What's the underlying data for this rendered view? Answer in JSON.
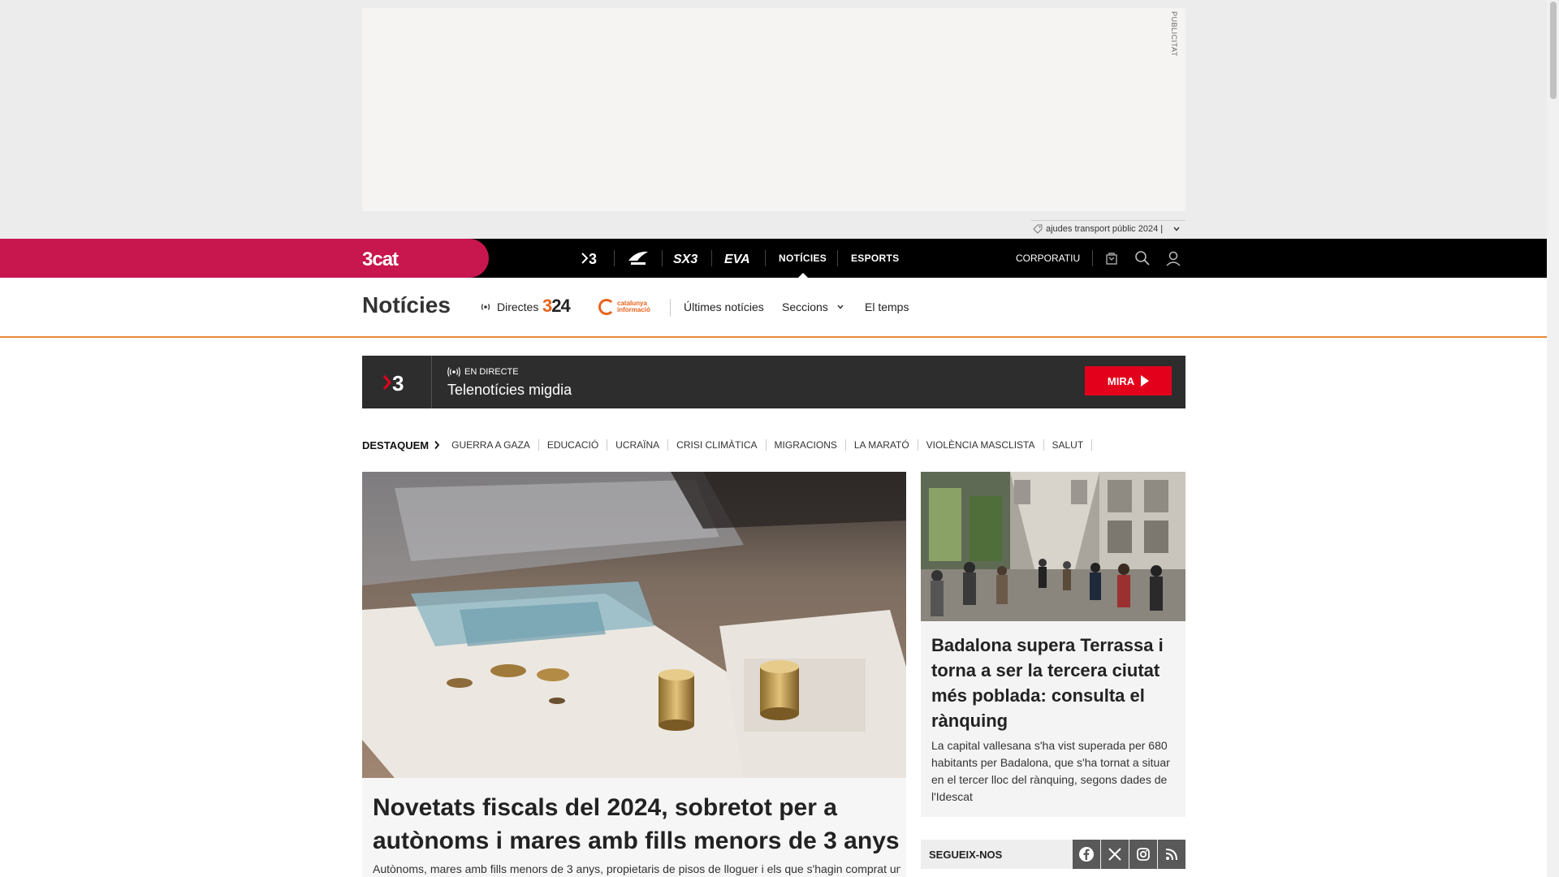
{
  "ad": {
    "label": "PUBLICITAT",
    "footer_text": "ajudes transport públic 2024 |"
  },
  "topnav": {
    "brand": "3cat",
    "channels": [
      {
        "name": "3-icon"
      },
      {
        "name": "catradio-icon",
        "label": "Cat ràdio"
      },
      {
        "name": "sx3-icon",
        "label": "SX3"
      },
      {
        "name": "eva-icon",
        "label": "EVA"
      }
    ],
    "noticies": "NOTÍCIES",
    "esports": "ESPORTS",
    "corporatiu": "CORPORATIU"
  },
  "section": {
    "title": "Notícies",
    "directes": "Directes",
    "logo_324_a": "3",
    "logo_324_b": "24",
    "logo_ci": "catalunya informació",
    "links": [
      "Últimes notícies",
      "Seccions",
      "El temps"
    ]
  },
  "live": {
    "channel": "3",
    "tag": "EN DIRECTE",
    "title": "Telenotícies migdia",
    "button": "MIRA"
  },
  "highlights": {
    "title": "DESTAQUEM",
    "items": [
      "GUERRA A GAZA",
      "EDUCACIÓ",
      "UCRAÏNA",
      "CRISI CLIMÀTICA",
      "MIGRACIONS",
      "LA MARATÓ",
      "VIOLÈNCIA MASCLISTA",
      "SALUT"
    ]
  },
  "main_story": {
    "headline": "Novetats fiscals del 2024, sobretot per a autònoms i mares amb fills menors de 3 anys",
    "summary": "Autònoms, mares amb fills menors de 3 anys, propietaris de pisos de lloguer i els que s'hagin comprat un"
  },
  "side_story": {
    "headline": "Badalona supera Terrassa i torna a ser la tercera ciutat més poblada: consulta el rànquing",
    "summary": "La capital vallesana s'ha vist superada per 680 habitants per Badalona, que s'ha tornat a situar en el tercer lloc del rànquing, segons dades de l'Idescat"
  },
  "social": {
    "label": "SEGUEIX-NOS",
    "icons": [
      "facebook-icon",
      "x-icon",
      "instagram-icon",
      "rss-icon"
    ]
  },
  "colors": {
    "brand": "#c8164e",
    "accent_orange": "#e8631c",
    "live_button": "#e3001b"
  }
}
